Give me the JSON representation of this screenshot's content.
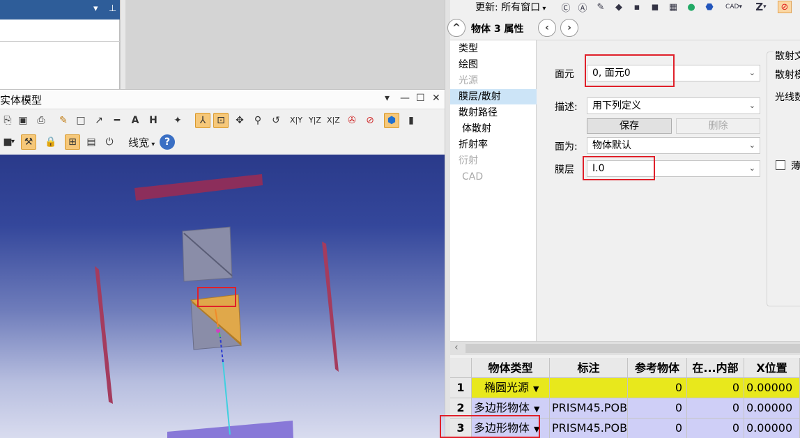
{
  "top_left_panel": {
    "title_controls": [
      "▾",
      "⊥"
    ]
  },
  "model_window": {
    "title": "实体模型",
    "window_buttons": [
      "▾",
      "—",
      "☐",
      "✕"
    ],
    "toolbar1": {
      "view_labels": [
        "X|Y",
        "Y|Z",
        "X|Z"
      ]
    },
    "toolbar2": {
      "line_width_label": "线宽"
    }
  },
  "right_toolbar": {
    "update_label": "更新: 所有窗口",
    "cad_label": "CAD",
    "z_label": "Z"
  },
  "property_panel": {
    "title": "物体   3 属性",
    "categories": [
      {
        "label": "类型",
        "state": "normal"
      },
      {
        "label": "绘图",
        "state": "normal"
      },
      {
        "label": "光源",
        "state": "disabled"
      },
      {
        "label": "膜层/散射",
        "state": "selected"
      },
      {
        "label": "散射路径",
        "state": "normal"
      },
      {
        "label": "体散射",
        "state": "normal"
      },
      {
        "label": "折射率",
        "state": "normal"
      },
      {
        "label": "衍射",
        "state": "disabled"
      },
      {
        "label": "CAD",
        "state": "disabled"
      }
    ],
    "form": {
      "face_label": "面元",
      "face_value": "0, 面元0",
      "desc_label": "描述:",
      "desc_value": "用下列定义",
      "save_button": "保存",
      "delete_button": "删除",
      "face_as_label": "面为:",
      "face_as_value": "物体默认",
      "coating_label": "膜层",
      "coating_value": "I.0"
    },
    "right_group": {
      "title": "散射文",
      "line1": "散射模",
      "line2": "光线数",
      "checkbox_label": "薄"
    }
  },
  "grid": {
    "columns": [
      "物体类型",
      "标注",
      "参考物体",
      "在...内部",
      "X位置"
    ],
    "rows": [
      {
        "index": "1",
        "type": "椭圆光源",
        "label": "",
        "ref": "0",
        "inside": "0",
        "x": "0.00000",
        "highlight": "#e8e81c"
      },
      {
        "index": "2",
        "type": "多边形物体",
        "label": "PRISM45.POB",
        "ref": "0",
        "inside": "0",
        "x": "0.00000",
        "highlight": "#cfcff7"
      },
      {
        "index": "3",
        "type": "多边形物体",
        "label": "PRISM45.POB",
        "ref": "0",
        "inside": "0",
        "x": "0.00000",
        "highlight": "#cfcff7"
      }
    ]
  },
  "colors": {
    "title_blue": "#2e5d99",
    "selection": "#cce4f7",
    "annotation_red": "#e0202a",
    "row_yellow": "#e8e81c",
    "row_lavender": "#cfcff7"
  }
}
